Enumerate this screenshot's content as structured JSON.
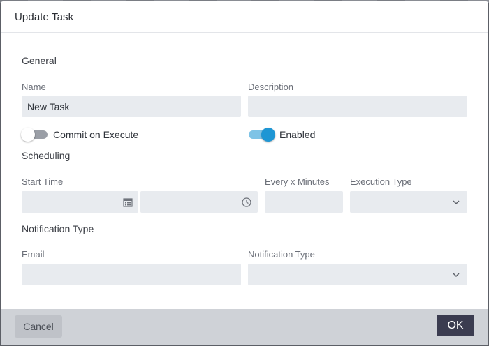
{
  "dialog": {
    "title": "Update Task"
  },
  "general": {
    "section_title": "General",
    "name_label": "Name",
    "name_value": "New Task",
    "description_label": "Description",
    "description_value": "",
    "commit_label": "Commit on Execute",
    "commit_enabled": false,
    "enabled_label": "Enabled",
    "enabled_on": true
  },
  "scheduling": {
    "section_title": "Scheduling",
    "start_time_label": "Start Time",
    "start_date_value": "",
    "start_time_value": "",
    "every_label": "Every x Minutes",
    "every_value": "",
    "execution_type_label": "Execution Type",
    "execution_type_value": ""
  },
  "notification": {
    "section_title": "Notification Type",
    "email_label": "Email",
    "email_value": "",
    "type_label": "Notification Type",
    "type_value": ""
  },
  "footer": {
    "cancel_label": "Cancel",
    "ok_label": "OK"
  },
  "icons": {
    "calendar": "calendar-icon",
    "clock": "clock-icon",
    "chevron": "chevron-down-icon"
  },
  "colors": {
    "accent": "#1e96d4",
    "ok_button": "#3b3c50",
    "field_bg": "#e8ebef"
  }
}
